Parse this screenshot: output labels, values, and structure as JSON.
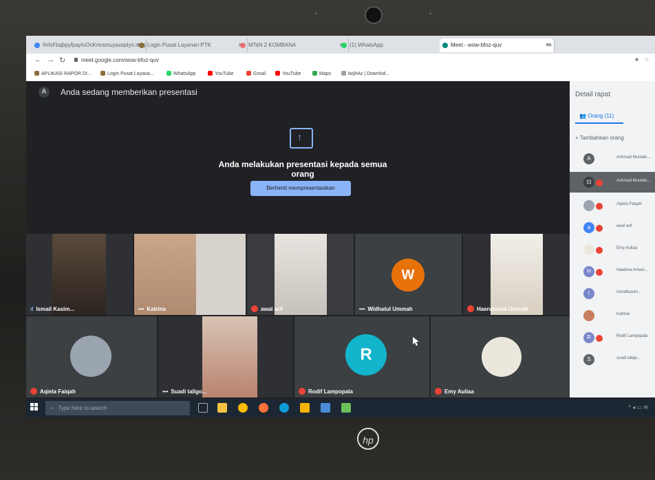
{
  "browser": {
    "tabs": [
      {
        "label": "%%FbqbpyfpayloOcKrivsmuyaxeplyo.mc.jrm"
      },
      {
        "label": "Login Pusat Layanan PTK"
      },
      {
        "label": "MTsN 2 KOMBANA"
      },
      {
        "label": "(1) WhatsApp"
      },
      {
        "label": "Meet - wow-bfoz-quv"
      }
    ],
    "url": "meet.google.com/wow-bfoz-quv",
    "bookmarks": [
      {
        "label": "APLIKASI RAPOR DI..."
      },
      {
        "label": "Login Pusat Layana..."
      },
      {
        "label": "WhatsApp"
      },
      {
        "label": "YouTube"
      },
      {
        "label": "Gmail"
      },
      {
        "label": "YouTube"
      },
      {
        "label": "Maps"
      },
      {
        "label": "bojhAz | Downlod..."
      }
    ]
  },
  "meet": {
    "presenter_initial": "A",
    "presenting_banner": "Anda sedang memberikan presentasi",
    "presenting_message": "Anda melakukan presentasi kepada semua orang",
    "stop_button": "Berhenti mempresentasikan",
    "tiles": [
      {
        "name": "Ismail Kasim..."
      },
      {
        "name": "Katrina"
      },
      {
        "name": "awal arif"
      },
      {
        "name": "Widhatul Ummah",
        "initial": "W"
      },
      {
        "name": "Haerunnisa Ummah"
      },
      {
        "name": "Aqiela Faiqah"
      },
      {
        "name": "Suadi taligo..."
      },
      {
        "name": "Rodif Lampopala",
        "initial": "R"
      },
      {
        "name": "Emy Auliaa"
      }
    ]
  },
  "panel": {
    "title": "Detail rapat",
    "people_tab": "Orang (11)",
    "add_people": "Tambahkan orang",
    "participants": [
      {
        "initial": "A",
        "name": "Achmad Mustaki..."
      },
      {
        "initial": "",
        "name": "Achmad Mustaki..."
      },
      {
        "initial": "",
        "name": "Aqiela Faiqah"
      },
      {
        "initial": "a",
        "name": "awal arif"
      },
      {
        "initial": "",
        "name": "Emy Auliaa"
      },
      {
        "initial": "H",
        "name": "Haedina Amoni..."
      },
      {
        "initial": "I",
        "name": "ismailkasim..."
      },
      {
        "initial": "",
        "name": "Katrina"
      },
      {
        "initial": "R",
        "name": "Rodif Lampopala"
      },
      {
        "initial": "S",
        "name": "suadi taligo..."
      }
    ]
  },
  "taskbar": {
    "search_placeholder": "Type here to search"
  },
  "device": {
    "logo": "hp"
  }
}
